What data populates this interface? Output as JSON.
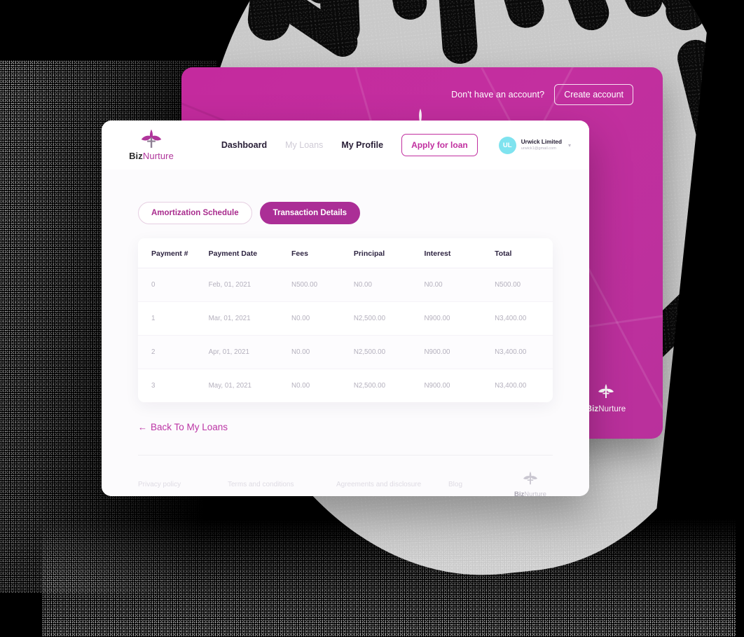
{
  "background": {
    "art_description": "abstract black and white striped disc pattern",
    "colors": {
      "dark": "#0a0a0a",
      "light": "#c9c9c9",
      "page": "#000000"
    }
  },
  "promo_panel": {
    "question": "Don't have an account?",
    "create_account_label": "Create account",
    "brand": {
      "prefix": "Biz",
      "suffix": "Nurture"
    },
    "accent": "#c42a9e"
  },
  "nav": {
    "brand": {
      "prefix": "Biz",
      "suffix": "Nurture"
    },
    "links": [
      {
        "label": "Dashboard",
        "state": "active"
      },
      {
        "label": "My Loans",
        "state": "muted"
      },
      {
        "label": "My Profile",
        "state": "active"
      }
    ],
    "apply_label": "Apply for loan",
    "user": {
      "initials": "UL",
      "name": "Urwick Limited",
      "email": "urwick1@gmail.com",
      "caret": "chevron-down"
    }
  },
  "tabs": [
    {
      "label": "Amortization Schedule",
      "active": false
    },
    {
      "label": "Transaction Details",
      "active": true
    }
  ],
  "table": {
    "columns": [
      "Payment #",
      "Payment Date",
      "Fees",
      "Principal",
      "Interest",
      "Total"
    ],
    "rows": [
      [
        "0",
        "Feb, 01, 2021",
        "N500.00",
        "N0.00",
        "N0.00",
        "N500.00"
      ],
      [
        "1",
        "Mar, 01, 2021",
        "N0.00",
        "N2,500.00",
        "N900.00",
        "N3,400.00"
      ],
      [
        "2",
        "Apr, 01, 2021",
        "N0.00",
        "N2,500.00",
        "N900.00",
        "N3,400.00"
      ],
      [
        "3",
        "May, 01, 2021",
        "N0.00",
        "N2,500.00",
        "N900.00",
        "N3,400.00"
      ]
    ]
  },
  "back_link": {
    "arrow": "←",
    "label": "Back To My Loans"
  },
  "footer": {
    "links": [
      "Privacy policy",
      "Terms and conditions",
      "Agreements and disclosure",
      "Blog"
    ],
    "brand": {
      "prefix": "Biz",
      "suffix": "Nurture"
    }
  },
  "colors": {
    "magenta": "#ab2e96",
    "magenta_light": "#c42a9e",
    "link_pink": "#bb35a5",
    "avatar_cyan": "#7fe3ef"
  }
}
